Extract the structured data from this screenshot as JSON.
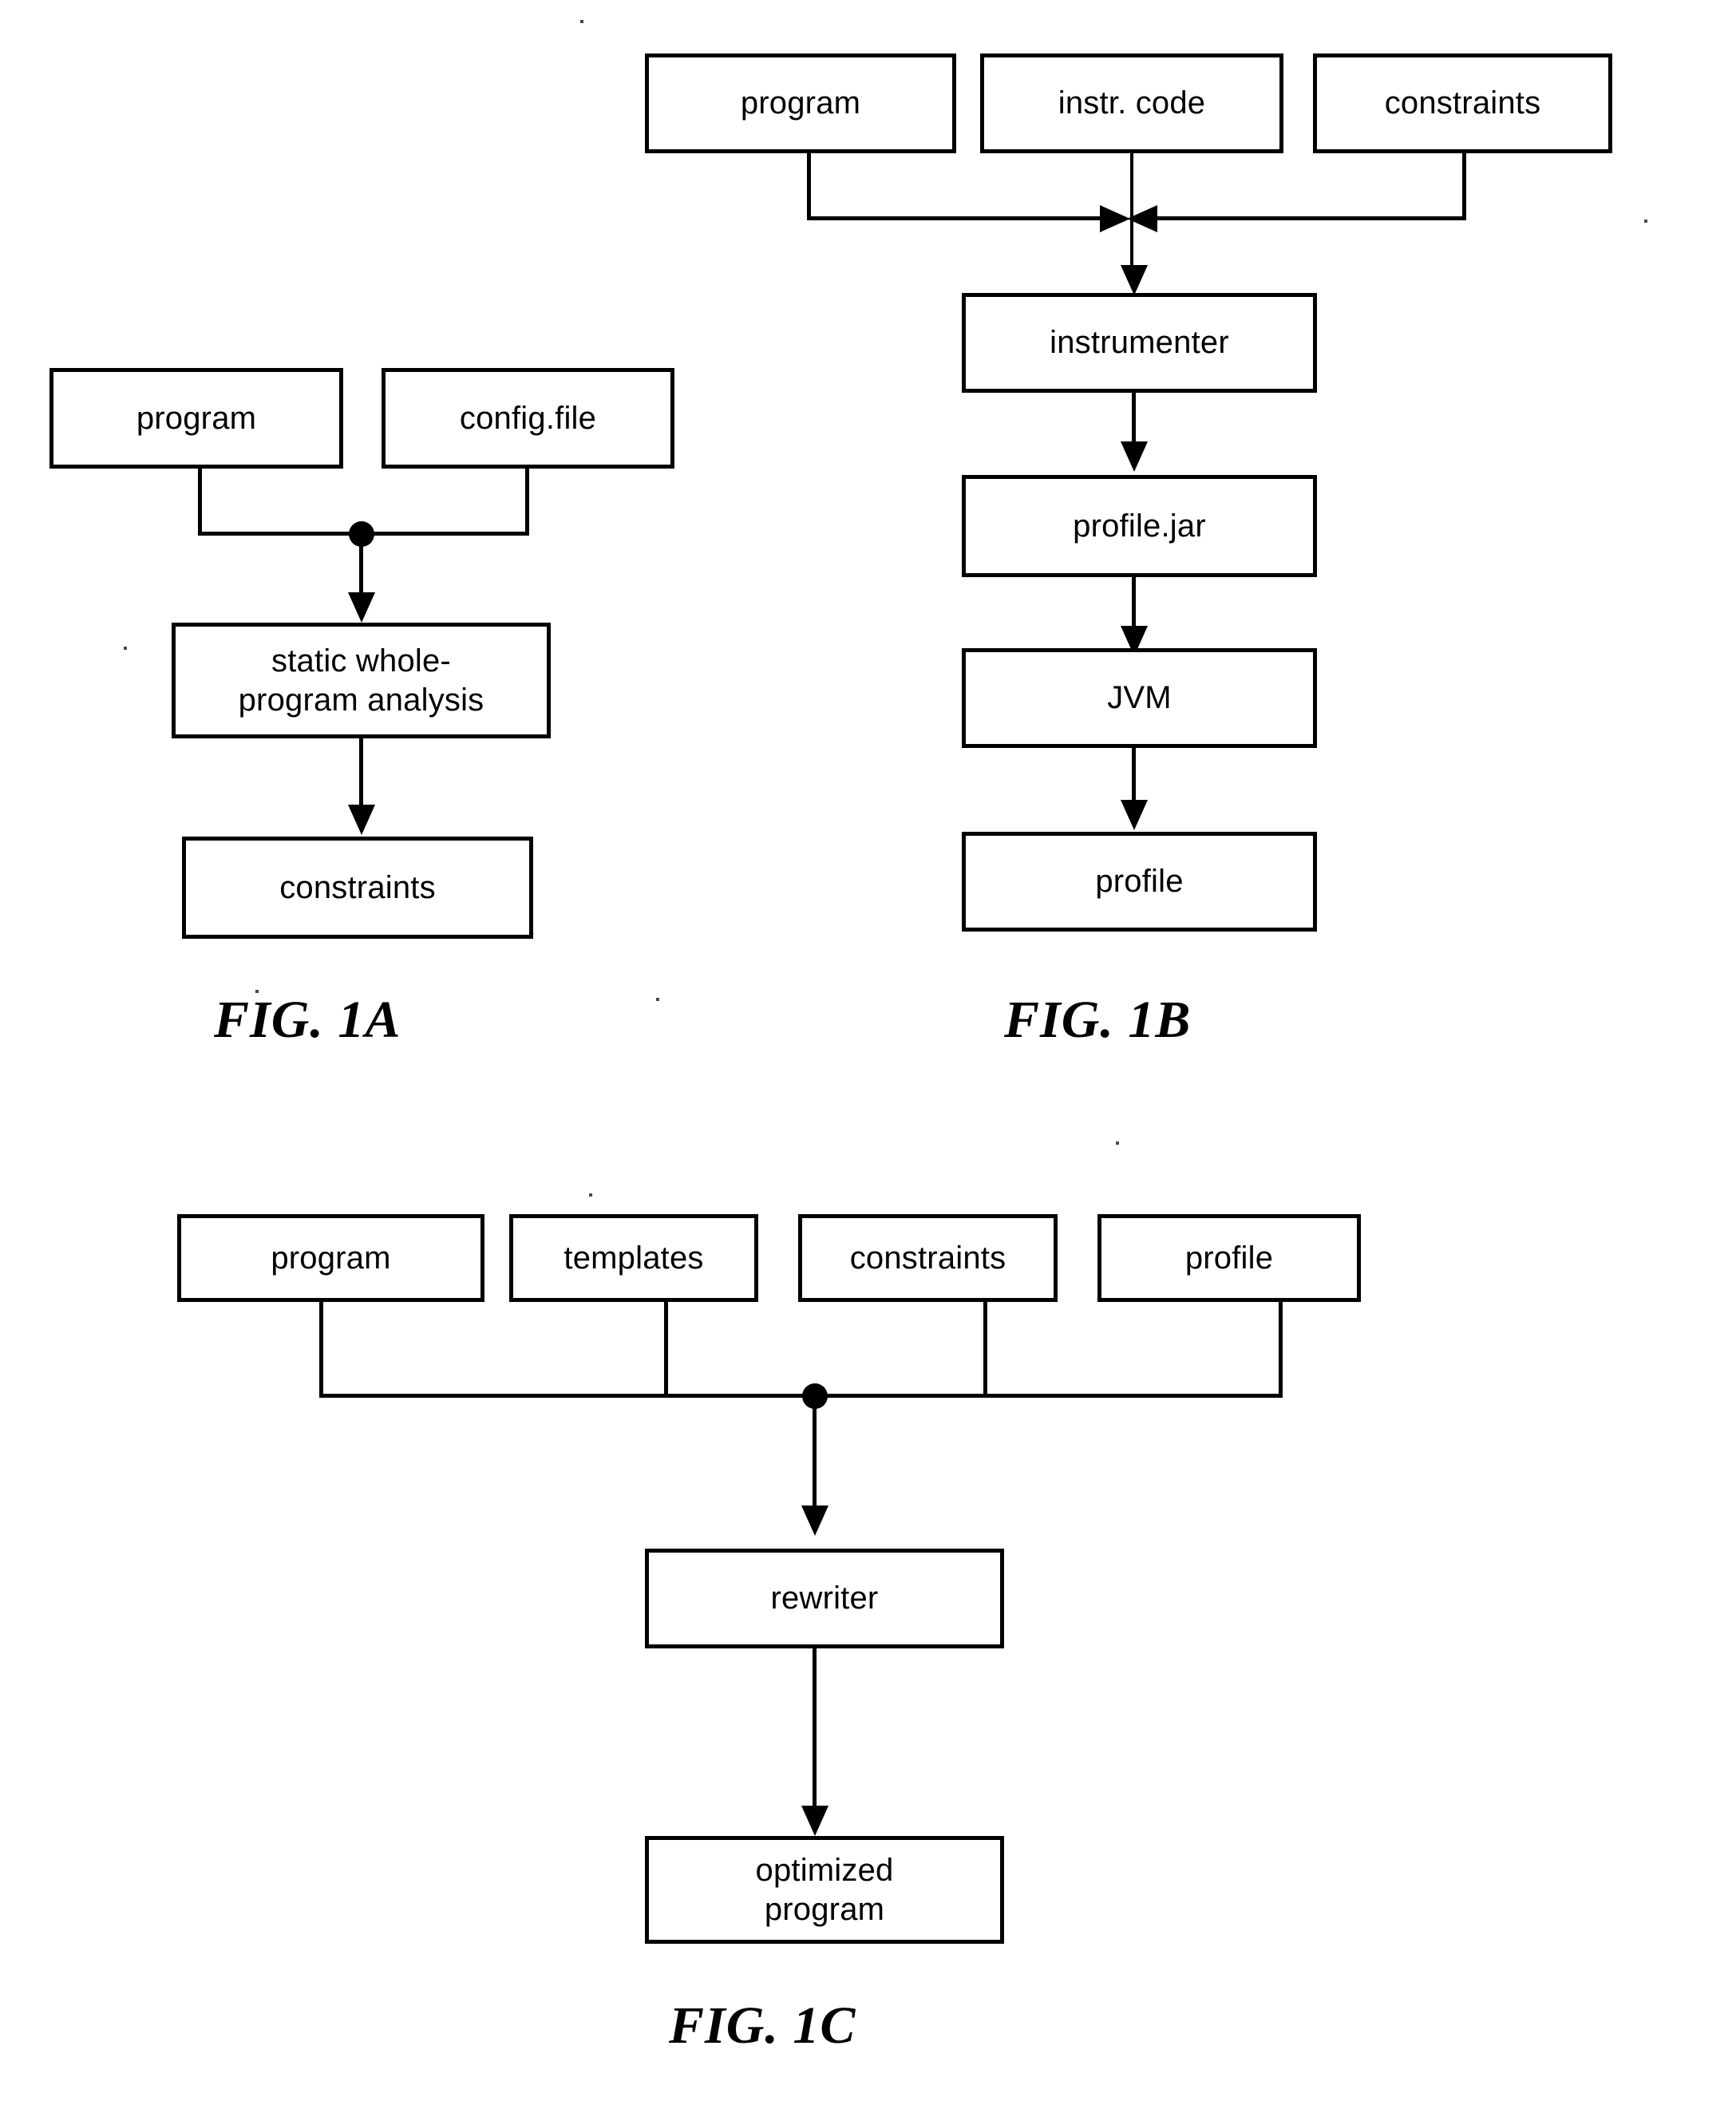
{
  "figures": [
    {
      "id": "fig-1a",
      "caption": "FIG. 1A",
      "nodes": {
        "program": "program",
        "config_file": "config.file",
        "analysis_line1": "static whole-",
        "analysis_line2": "program analysis",
        "constraints": "constraints"
      }
    },
    {
      "id": "fig-1b",
      "caption": "FIG. 1B",
      "nodes": {
        "program": "program",
        "instr_code": "instr. code",
        "constraints": "constraints",
        "instrumenter": "instrumenter",
        "profile_jar": "profile.jar",
        "jvm": "JVM",
        "profile": "profile"
      }
    },
    {
      "id": "fig-1c",
      "caption": "FIG. 1C",
      "nodes": {
        "program": "program",
        "templates": "templates",
        "constraints": "constraints",
        "profile": "profile",
        "rewriter": "rewriter",
        "optimized_line1": "optimized",
        "optimized_line2": "program"
      }
    }
  ],
  "colors": {
    "ink": "#000000",
    "paper": "#ffffff"
  }
}
